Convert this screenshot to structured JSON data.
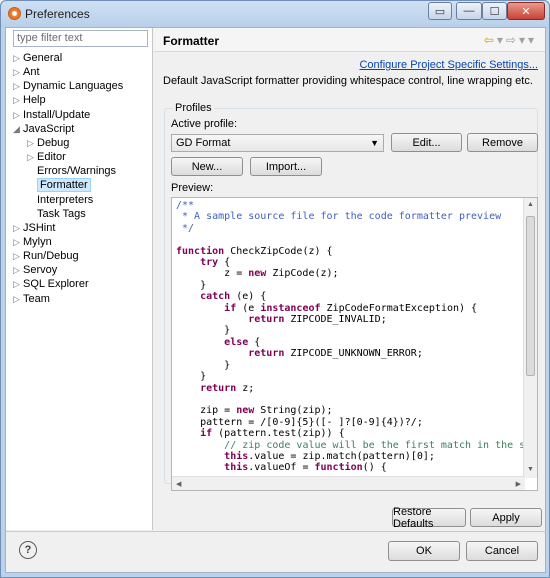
{
  "window": {
    "title": "Preferences"
  },
  "filter": {
    "placeholder": "type filter text"
  },
  "tree": [
    {
      "label": "General",
      "twisty": "▷",
      "indent": 0
    },
    {
      "label": "Ant",
      "twisty": "▷",
      "indent": 0
    },
    {
      "label": "Dynamic Languages",
      "twisty": "▷",
      "indent": 0
    },
    {
      "label": "Help",
      "twisty": "▷",
      "indent": 0
    },
    {
      "label": "Install/Update",
      "twisty": "▷",
      "indent": 0
    },
    {
      "label": "JavaScript",
      "twisty": "◢",
      "indent": 0
    },
    {
      "label": "Debug",
      "twisty": "▷",
      "indent": 1
    },
    {
      "label": "Editor",
      "twisty": "▷",
      "indent": 1
    },
    {
      "label": "Errors/Warnings",
      "twisty": "",
      "indent": 1
    },
    {
      "label": "Formatter",
      "twisty": "",
      "indent": 1,
      "selected": true
    },
    {
      "label": "Interpreters",
      "twisty": "",
      "indent": 1
    },
    {
      "label": "Task Tags",
      "twisty": "",
      "indent": 1
    },
    {
      "label": "JSHint",
      "twisty": "▷",
      "indent": 0
    },
    {
      "label": "Mylyn",
      "twisty": "▷",
      "indent": 0
    },
    {
      "label": "Run/Debug",
      "twisty": "▷",
      "indent": 0
    },
    {
      "label": "Servoy",
      "twisty": "▷",
      "indent": 0
    },
    {
      "label": "SQL Explorer",
      "twisty": "▷",
      "indent": 0
    },
    {
      "label": "Team",
      "twisty": "▷",
      "indent": 0
    }
  ],
  "page": {
    "title": "Formatter",
    "link": "Configure Project Specific Settings...",
    "description": "Default JavaScript formatter providing whitespace control, line wrapping etc.",
    "profiles_group": "Profiles",
    "active_profile_label": "Active profile:",
    "active_profile_value": "GD Format",
    "edit_button": "Edit...",
    "remove_button": "Remove",
    "new_button": "New...",
    "import_button": "Import...",
    "preview_label": "Preview:"
  },
  "buttons": {
    "restore_defaults": "Restore Defaults",
    "apply": "Apply",
    "ok": "OK",
    "cancel": "Cancel"
  },
  "icons": {
    "help": "?"
  }
}
